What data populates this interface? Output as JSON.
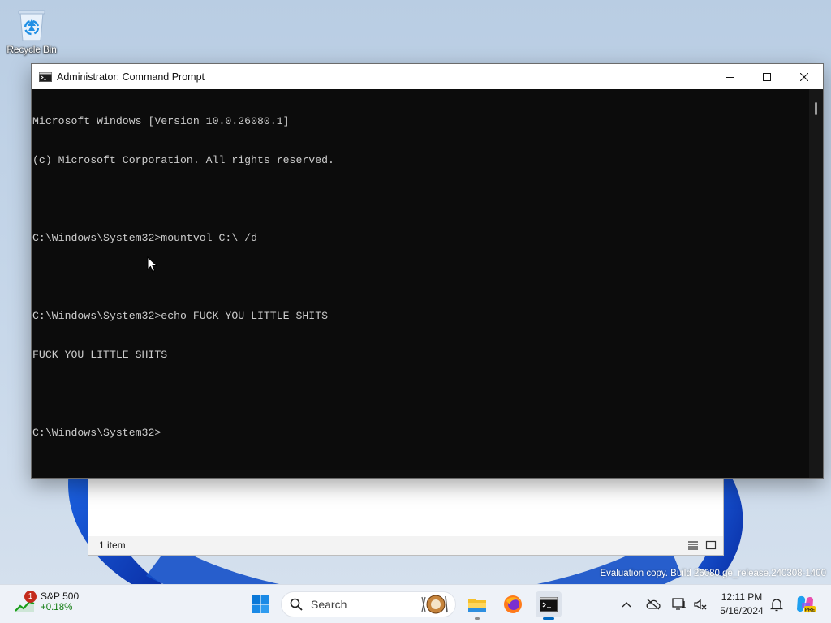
{
  "desktop": {
    "recycle_bin_label": "Recycle Bin"
  },
  "cmd_window": {
    "title": "Administrator: Command Prompt",
    "icon": "cmd-icon",
    "lines": [
      "Microsoft Windows [Version 10.0.26080.1]",
      "(c) Microsoft Corporation. All rights reserved.",
      "",
      "C:\\Windows\\System32>mountvol C:\\ /d",
      "",
      "C:\\Windows\\System32>echo FUCK YOU LITTLE SHITS",
      "FUCK YOU LITTLE SHITS",
      "",
      "C:\\Windows\\System32>"
    ],
    "controls": {
      "minimize": "minimize-icon",
      "maximize": "maximize-icon",
      "close": "close-icon"
    },
    "background": "#0c0c0c",
    "text_color": "#cccccc"
  },
  "explorer_window": {
    "status": "1 item"
  },
  "watermark": "Evaluation copy. Build 26080.ge_release.240308-1400",
  "taskbar": {
    "widget": {
      "badge": "1",
      "name": "S&P 500",
      "change": "+0.18%"
    },
    "search_placeholder": "Search",
    "pinned": [
      "start-icon",
      "file-explorer-icon",
      "firefox-icon",
      "terminal-icon"
    ],
    "clock": {
      "time": "12:11 PM",
      "date": "5/16/2024"
    },
    "tray_icons": [
      "chevron-up-icon",
      "onedrive-offline-icon",
      "network-icon",
      "volume-icon",
      "notifications-icon",
      "copilot-icon"
    ],
    "copilot_badge": "PRE"
  },
  "colors": {
    "accent": "#0067c0",
    "taskbar": "#eef2f8",
    "wallpaper_blue": "#1f5bd8"
  }
}
